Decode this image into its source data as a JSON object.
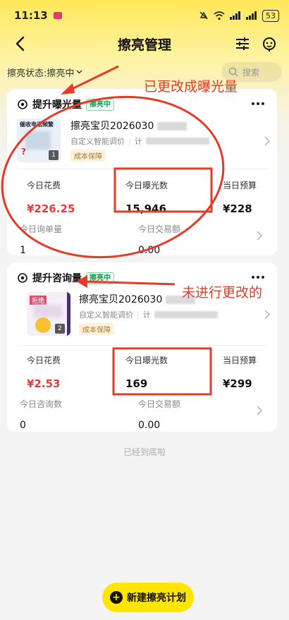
{
  "status_bar": {
    "time": "11:13",
    "battery": "53"
  },
  "nav": {
    "title": "擦亮管理"
  },
  "filter": {
    "status_label": "擦亮状态:擦亮中",
    "search_placeholder": "搜索"
  },
  "cards": [
    {
      "title": "提升曝光量",
      "badge": "擦亮中",
      "product_name": "擦亮宝贝2026030",
      "product_sub_a": "自定义智能调价",
      "product_sub_b": "计",
      "product_tag": "成本保障",
      "image_count": "1",
      "thumb_text": "催收电话频繁",
      "metrics_top": [
        {
          "label": "今日花费",
          "value": "¥226.25"
        },
        {
          "label": "今日曝光数",
          "value": "15,946"
        },
        {
          "label": "当日预算",
          "value": "¥228"
        }
      ],
      "metrics_bottom": [
        {
          "label": "今日询单量",
          "value": "1"
        },
        {
          "label": "今日交易额",
          "value": "0.00"
        }
      ]
    },
    {
      "title": "提升咨询量",
      "badge": "擦亮中",
      "product_name": "擦亮宝贝2026030",
      "product_sub_a": "自定义智能调价",
      "product_sub_b": "计",
      "product_tag": "成本保障",
      "image_count": "2",
      "thumb_text": "拒绝",
      "metrics_top": [
        {
          "label": "今日花费",
          "value": "¥2.53"
        },
        {
          "label": "今日曝光数",
          "value": "169"
        },
        {
          "label": "当日预算",
          "value": "¥299"
        }
      ],
      "metrics_bottom": [
        {
          "label": "今日咨询数",
          "value": "0"
        },
        {
          "label": "今日交易额",
          "value": "0.00"
        }
      ]
    }
  ],
  "footer": {
    "end_text": "已经到底啦",
    "new_plan_label": "新建擦亮计划"
  },
  "annotations": {
    "changed_note": "已更改成曝光量",
    "unchanged_note": "未进行更改的",
    "color": "#e23b28"
  },
  "colors": {
    "accent_yellow": "#ffe500",
    "price_red": "#e83a3a",
    "badge_green": "#1b9e5a"
  }
}
